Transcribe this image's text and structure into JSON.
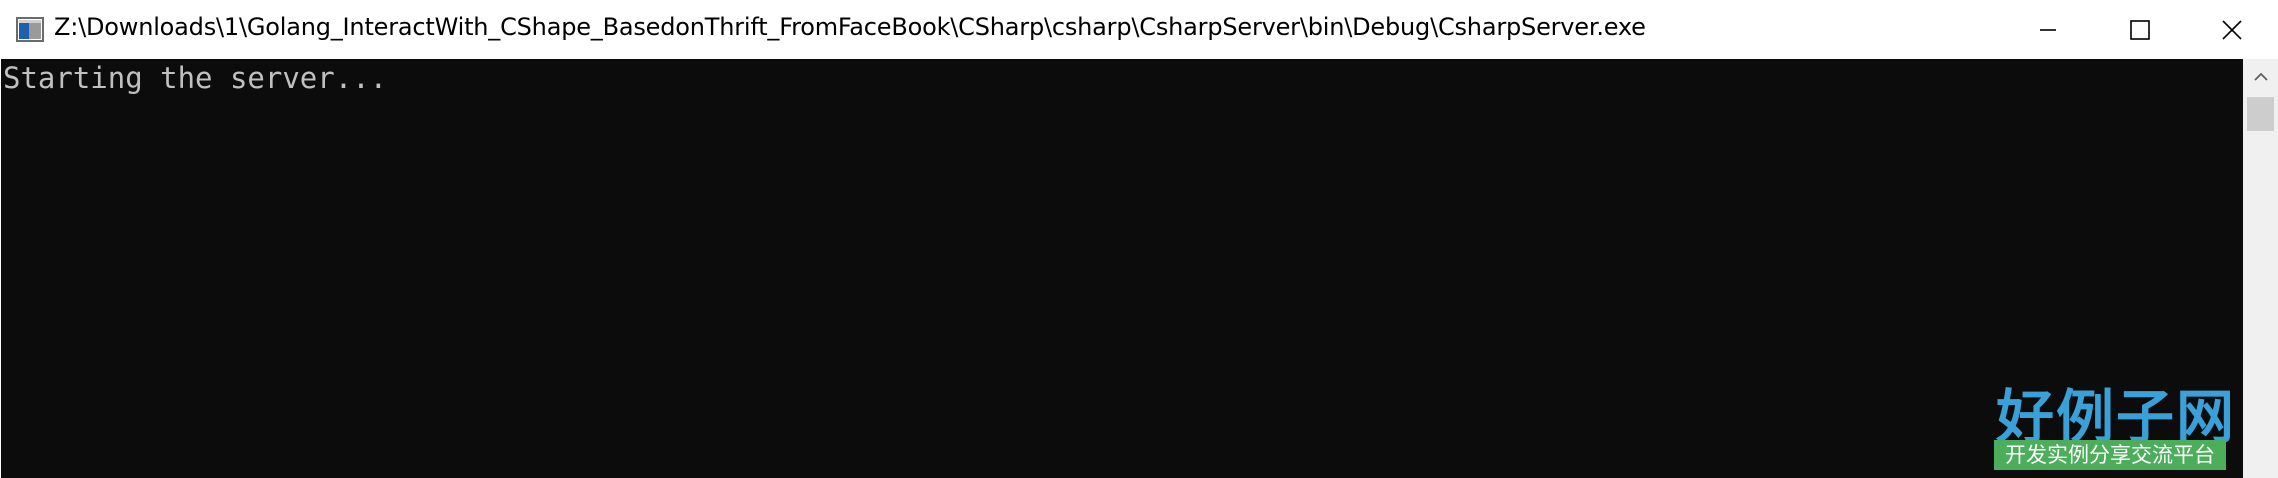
{
  "window": {
    "title": "Z:\\Downloads\\1\\Golang_InteractWith_CShape_BasedonThrift_FromFaceBook\\CSharp\\csharp\\CsharpServer\\bin\\Debug\\CsharpServer.exe",
    "icon": "console-app-icon",
    "controls": {
      "minimize_icon": "minimize-icon",
      "maximize_icon": "maximize-icon",
      "close_icon": "close-icon"
    }
  },
  "console": {
    "lines": [
      "Starting the server..."
    ],
    "background_color": "#0c0c0c",
    "text_color": "#c0c0c0"
  },
  "scrollbar": {
    "up_arrow_icon": "scroll-up-arrow-icon"
  },
  "watermark": {
    "title": "好例子网",
    "subtitle": "开发实例分享交流平台"
  }
}
